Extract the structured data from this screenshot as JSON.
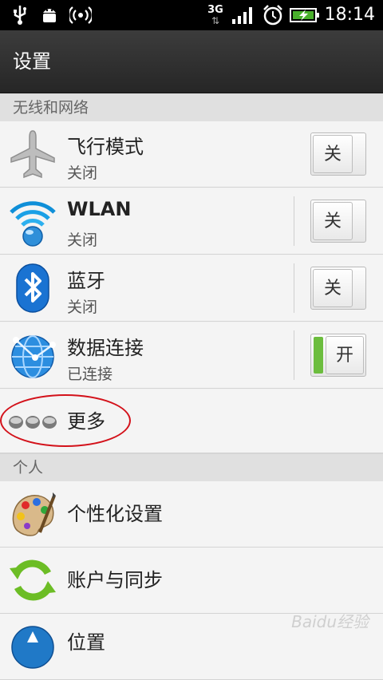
{
  "status_bar": {
    "time": "18:14",
    "network_type": "3G",
    "icons": [
      "usb-icon",
      "android-debug-icon",
      "wireless-hotspot-icon",
      "network-3g-icon",
      "signal-icon",
      "alarm-icon",
      "battery-charging-icon"
    ]
  },
  "header": {
    "title": "设置"
  },
  "sections": {
    "wireless": {
      "title": "无线和网络"
    },
    "personal": {
      "title": "个人"
    }
  },
  "items": {
    "airplane": {
      "label": "飞行模式",
      "status": "关闭",
      "toggle": "关"
    },
    "wlan": {
      "label": "WLAN",
      "status": "关闭",
      "toggle": "关"
    },
    "bluetooth": {
      "label": "蓝牙",
      "status": "关闭",
      "toggle": "关"
    },
    "data": {
      "label": "数据连接",
      "status": "已连接",
      "toggle": "开"
    },
    "more": {
      "label": "更多"
    },
    "personalize": {
      "label": "个性化设置"
    },
    "accounts": {
      "label": "账户与同步"
    },
    "location": {
      "label": "位置"
    }
  },
  "colors": {
    "toggle_on": "#6cbd3e",
    "annotation": "#d3111a"
  },
  "watermark": "Baidu经验"
}
